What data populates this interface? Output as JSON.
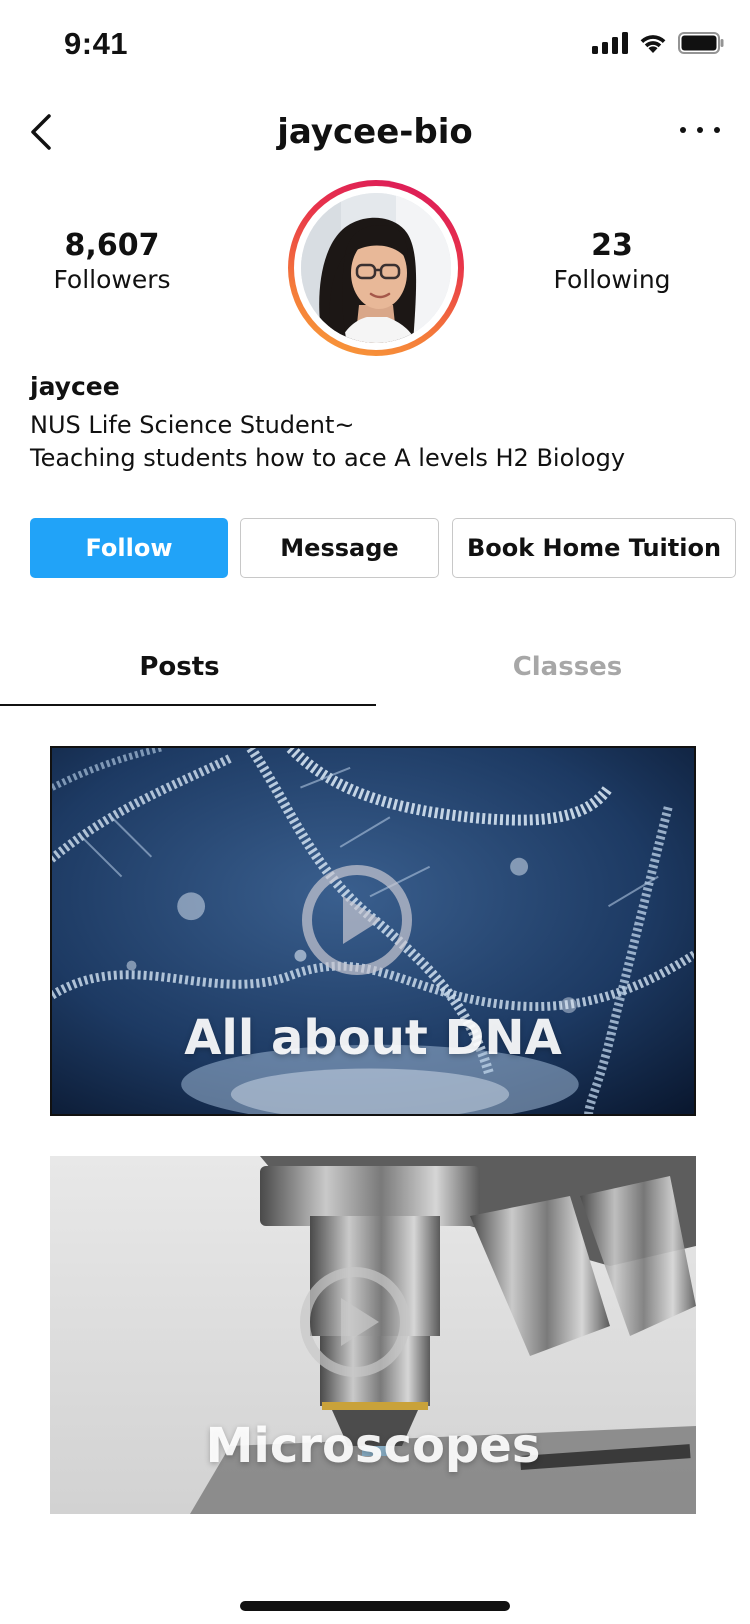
{
  "status_bar": {
    "time": "9:41"
  },
  "header": {
    "title": "jaycee-bio"
  },
  "profile": {
    "followers_count": "8,607",
    "followers_label": "Followers",
    "following_count": "23",
    "following_label": "Following",
    "name": "jaycee",
    "bio_line1": "NUS Life Science Student~",
    "bio_line2": "Teaching students how to ace A levels H2 Biology"
  },
  "actions": {
    "follow_label": "Follow",
    "message_label": "Message",
    "book_label": "Book Home Tuition"
  },
  "tabs": [
    {
      "label": "Posts",
      "active": true
    },
    {
      "label": "Classes",
      "active": false
    }
  ],
  "posts": [
    {
      "title": "All about DNA"
    },
    {
      "title": "Microscopes"
    }
  ],
  "colors": {
    "accent": "#21a3f8",
    "inactive_tab": "#a7a7a7",
    "ring_gradient": [
      "#d9155d",
      "#f9a038"
    ]
  },
  "icons": [
    "back-chevron-icon",
    "more-options-icon",
    "signal-icon",
    "wifi-icon",
    "battery-icon",
    "play-icon"
  ]
}
